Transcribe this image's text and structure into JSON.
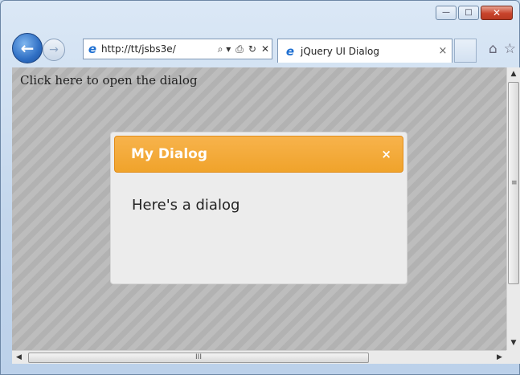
{
  "window": {
    "minimize_glyph": "—",
    "maximize_glyph": "□",
    "close_glyph": "✕"
  },
  "nav": {
    "back_glyph": "←",
    "forward_glyph": "→",
    "address": "http://tt/jsbs3e/",
    "address_controls": [
      "⌕ ▾",
      "⎙",
      "↻",
      "✕"
    ],
    "ie_glyph": "e"
  },
  "tab": {
    "title": "jQuery UI Dialog",
    "close_glyph": "×",
    "ie_glyph": "e"
  },
  "toolbar": {
    "home_glyph": "⌂",
    "favorites_glyph": "☆"
  },
  "page": {
    "link_text": "Click here to open the dialog"
  },
  "dialog": {
    "title": "My Dialog",
    "close_glyph": "×",
    "body_text": "Here's a dialog",
    "accent_color": "#f0a32b"
  },
  "scroll": {
    "up_glyph": "▲",
    "down_glyph": "▼",
    "left_glyph": "◀",
    "right_glyph": "▶",
    "grip_v": "≡",
    "grip_h": "III"
  }
}
